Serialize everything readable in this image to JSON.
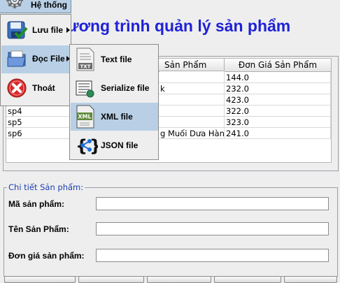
{
  "menubar": {
    "system_menu": "Hệ thống"
  },
  "system_menu_items": [
    {
      "label": "Lưu file",
      "icon": "save-icon"
    },
    {
      "label": "Đọc File",
      "icon": "open-folder-icon"
    },
    {
      "label": "Thoát",
      "icon": "exit-icon"
    }
  ],
  "read_submenu_items": [
    {
      "label": "Text file",
      "icon": "text-file-icon",
      "icon_text": "TXT"
    },
    {
      "label": "Serialize file",
      "icon": "serialize-file-icon"
    },
    {
      "label": "XML file",
      "icon": "xml-file-icon",
      "icon_text": "XML"
    },
    {
      "label": "JSON file",
      "icon": "json-file-icon",
      "icon_text": "{ }"
    }
  ],
  "app_title_visible": "ương trình quản lý sản phẩm",
  "table": {
    "columns": [
      "",
      "Sản Phẩm",
      "Đơn Giá Sản Phẩm"
    ],
    "rows": [
      {
        "code": "",
        "name": "",
        "price": "144.0"
      },
      {
        "code": "",
        "name": "k",
        "price": "232.0"
      },
      {
        "code": "",
        "name": "",
        "price": "423.0"
      },
      {
        "code": "sp4",
        "name": "",
        "price": "322.0"
      },
      {
        "code": "sp5",
        "name": "",
        "price": "323.0"
      },
      {
        "code": "sp6",
        "name": "g Muối Dưa Hành",
        "price": "241.0"
      }
    ]
  },
  "detail": {
    "legend": "Chi tiết Sản phẩm:",
    "code_label": "Mã sản phẩm:",
    "name_label": "Tên Sản Phẩm:",
    "price_label": "Đơn giá sản phẩm:",
    "code_value": "",
    "name_value": "",
    "price_value": ""
  },
  "colors": {
    "title": "#1f22d6",
    "selection": "#b8cfe5",
    "legend": "#1b3fb0"
  }
}
